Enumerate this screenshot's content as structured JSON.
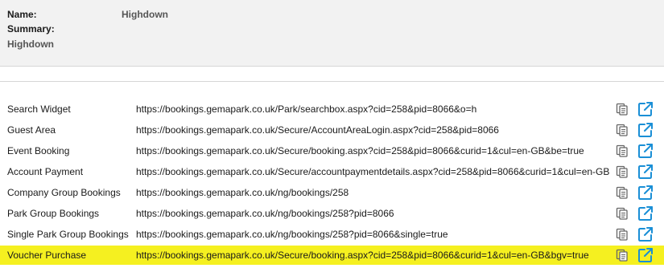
{
  "summary": {
    "name_label": "Name:",
    "name_value": "Highdown",
    "summary_label": "Summary:",
    "summary_value": "Highdown"
  },
  "links": [
    {
      "label": "Search Widget",
      "url": "https://bookings.gemapark.co.uk/Park/searchbox.aspx?cid=258&pid=8066&o=h",
      "highlighted": false
    },
    {
      "label": "Guest Area",
      "url": "https://bookings.gemapark.co.uk/Secure/AccountAreaLogin.aspx?cid=258&pid=8066",
      "highlighted": false
    },
    {
      "label": "Event Booking",
      "url": "https://bookings.gemapark.co.uk/Secure/booking.aspx?cid=258&pid=8066&curid=1&cul=en-GB&be=true",
      "highlighted": false
    },
    {
      "label": "Account Payment",
      "url": "https://bookings.gemapark.co.uk/Secure/accountpaymentdetails.aspx?cid=258&pid=8066&curid=1&cul=en-GB",
      "highlighted": false
    },
    {
      "label": "Company Group Bookings",
      "url": "https://bookings.gemapark.co.uk/ng/bookings/258",
      "highlighted": false
    },
    {
      "label": "Park Group Bookings",
      "url": "https://bookings.gemapark.co.uk/ng/bookings/258?pid=8066",
      "highlighted": false
    },
    {
      "label": "Single Park Group Bookings",
      "url": "https://bookings.gemapark.co.uk/ng/bookings/258?pid=8066&single=true",
      "highlighted": false
    },
    {
      "label": "Voucher Purchase",
      "url": "https://bookings.gemapark.co.uk/Secure/booking.aspx?cid=258&pid=8066&curid=1&cul=en-GB&bgv=true",
      "highlighted": true
    }
  ],
  "icons": {
    "copy": "copy-icon",
    "open": "external-link-icon"
  },
  "colors": {
    "highlight": "#f5f020",
    "icon_blue": "#1a8fd6",
    "icon_grey": "#666666",
    "panel_bg": "#f2f2f2"
  }
}
